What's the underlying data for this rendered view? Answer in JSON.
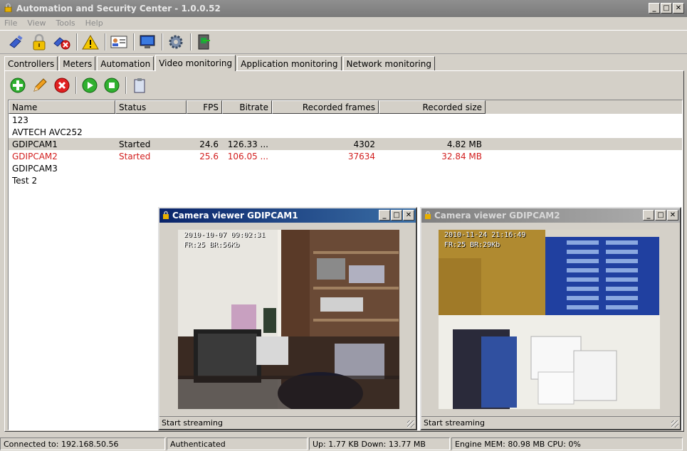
{
  "window": {
    "title": "Automation and Security Center - 1.0.0.52",
    "controls": {
      "min": "_",
      "max": "□",
      "close": "✕"
    }
  },
  "menu": [
    "File",
    "View",
    "Tools",
    "Help"
  ],
  "toolbar_icons": [
    "connect-icon",
    "lock-icon",
    "disconnect-icon",
    "warning-icon",
    "user-card-icon",
    "monitor-icon",
    "gear-icon",
    "exit-icon"
  ],
  "tabs": [
    "Controllers",
    "Meters",
    "Automation",
    "Video monitoring",
    "Application monitoring",
    "Network monitoring"
  ],
  "active_tab": "Video monitoring",
  "subtoolbar_icons": [
    "add-icon",
    "edit-icon",
    "delete-icon",
    "play-icon",
    "stop-icon",
    "clipboard-icon"
  ],
  "table": {
    "columns": [
      "Name",
      "Status",
      "FPS",
      "Bitrate",
      "Recorded frames",
      "Recorded size"
    ],
    "rows": [
      {
        "name": "123",
        "status": "",
        "fps": "",
        "bitrate": "",
        "frames": "",
        "size": ""
      },
      {
        "name": "AVTECH AVC252",
        "status": "",
        "fps": "",
        "bitrate": "",
        "frames": "",
        "size": ""
      },
      {
        "name": "GDIPCAM1",
        "status": "Started",
        "fps": "24.6",
        "bitrate": "126.33 ...",
        "frames": "4302",
        "size": "4.82 MB"
      },
      {
        "name": "GDIPCAM2",
        "status": "Started",
        "fps": "25.6",
        "bitrate": "106.05 ...",
        "frames": "37634",
        "size": "32.84 MB"
      },
      {
        "name": "GDIPCAM3",
        "status": "",
        "fps": "",
        "bitrate": "",
        "frames": "",
        "size": ""
      },
      {
        "name": "Test 2",
        "status": "",
        "fps": "",
        "bitrate": "",
        "frames": "",
        "size": ""
      }
    ]
  },
  "viewers": [
    {
      "title": "Camera viewer GDIPCAM1",
      "overlay_line1": "2010-10-07 09:02:31",
      "overlay_line2": "FR:25 BR:56Kb",
      "status": "Start streaming"
    },
    {
      "title": "Camera viewer GDIPCAM2",
      "overlay_line1": "2010-11-24 21:16:49",
      "overlay_line2": "FR:25 BR:29Kb",
      "status": "Start streaming"
    }
  ],
  "statusbar": {
    "connected": "Connected to: 192.168.50.56",
    "auth": "Authenticated",
    "traffic": "Up: 1.77 KB Down: 13.77 MB",
    "engine": "Engine MEM: 80.98 MB CPU: 0%"
  },
  "colors": {
    "accent_title": "#0a246a",
    "error_row": "#d21e1e",
    "face": "#d4d0c8"
  }
}
